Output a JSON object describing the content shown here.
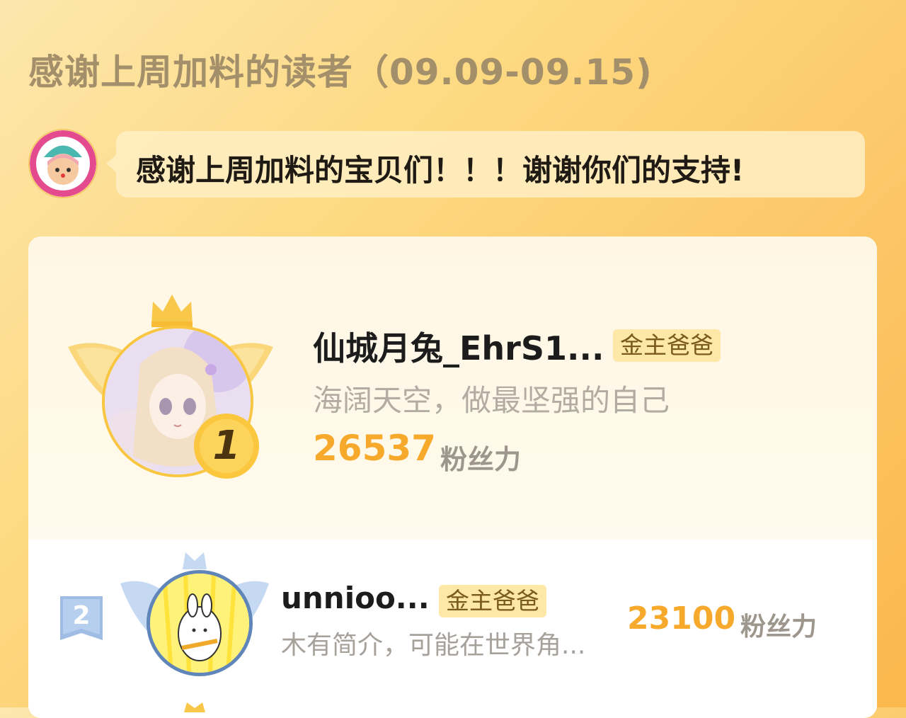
{
  "header": {
    "title": "感谢上周加料的读者（09.09-09.15)"
  },
  "author_message": {
    "text": "感谢上周加料的宝贝们！！！谢谢你们的支持!"
  },
  "leaderboard": [
    {
      "rank": "1",
      "name": "仙城月兔_EhrS1...",
      "tag": "金主爸爸",
      "bio": "海阔天空，做最坚强的自己",
      "score": "26537",
      "unit": "粉丝力"
    },
    {
      "rank": "2",
      "name": "unnioo...",
      "tag": "金主爸爸",
      "bio": "木有简介，可能在世界角...",
      "score": "23100",
      "unit": "粉丝力"
    }
  ],
  "colors": {
    "accent": "#f6a92b",
    "gold": "#f8c641",
    "silver": "#8fb2e0",
    "title": "#a38f6a"
  },
  "icons": [
    "crown-icon",
    "wings-icon",
    "rank-badge-icon"
  ]
}
